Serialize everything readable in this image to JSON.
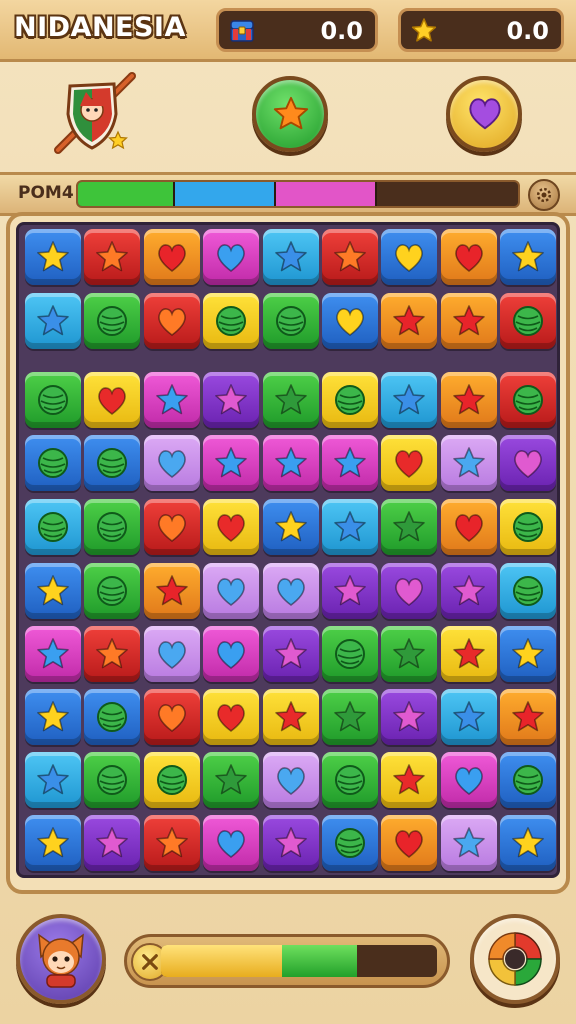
{
  "header": {
    "title": "NIDANESIA",
    "moves": {
      "value": "0.0",
      "icon": "treasure-chest-icon"
    },
    "stars": {
      "value": "0.0",
      "icon": "star-icon"
    }
  },
  "toolbar": {
    "badge_icon": "hero-shield-badge-icon",
    "star_booster_icon": "orange-star-booster-icon",
    "heart_booster_icon": "purple-heart-booster-icon"
  },
  "score_panel": {
    "label": "POM4",
    "segments": [
      {
        "color": "#3ec43a",
        "fraction": 0.22
      },
      {
        "color": "#33a7ec",
        "fraction": 0.23
      },
      {
        "color": "#e255c8",
        "fraction": 0.23
      }
    ],
    "settings_icon": "gear-icon"
  },
  "board": {
    "rows": 10,
    "cols": 9,
    "tiles": [
      [
        "blue:star",
        "red:star",
        "orange:heart",
        "magenta:heart",
        "cyan:star",
        "red:star",
        "blue:heart",
        "orange:heart",
        "blue:star"
      ],
      [
        "cyan:star",
        "green:ball",
        "red:heart",
        "yellow:ball",
        "green:ball",
        "blue:heart",
        "orange:star",
        "orange:star",
        "red:ball"
      ],
      [
        "green:ball",
        "yellow:heart",
        "magenta:star",
        "purple:star",
        "green:star",
        "yellow:ball",
        "cyan:star",
        "orange:star",
        "red:ball"
      ],
      [
        "blue:ball",
        "blue:ball",
        "lavender:heart",
        "magenta:star",
        "magenta:star",
        "magenta:star",
        "yellow:heart",
        "lavender:star",
        "purple:heart"
      ],
      [
        "cyan:ball",
        "green:ball",
        "red:heart",
        "yellow:heart",
        "blue:star",
        "cyan:star",
        "green:star",
        "orange:heart",
        "yellow:ball"
      ],
      [
        "blue:star",
        "green:ball",
        "orange:star",
        "lavender:heart",
        "lavender:heart",
        "purple:star",
        "purple:heart",
        "purple:star",
        "cyan:ball"
      ],
      [
        "magenta:star",
        "red:star",
        "lavender:heart",
        "magenta:heart",
        "purple:star",
        "green:ball",
        "green:star",
        "yellow:star",
        "blue:star"
      ],
      [
        "blue:star",
        "blue:ball",
        "red:heart",
        "yellow:heart",
        "yellow:star",
        "green:star",
        "purple:star",
        "cyan:star",
        "orange:star"
      ],
      [
        "cyan:star",
        "green:ball",
        "yellow:ball",
        "green:star",
        "lavender:heart",
        "green:ball",
        "yellow:star",
        "magenta:heart",
        "blue:ball"
      ],
      [
        "blue:star",
        "purple:star",
        "red:star",
        "magenta:heart",
        "purple:star",
        "blue:ball",
        "orange:heart",
        "lavender:star",
        "blue:star"
      ]
    ]
  },
  "bottom": {
    "avatar_icon": "cat-hero-avatar-icon",
    "cancel_icon": "close-icon",
    "progress": {
      "yellow_fraction": 0.44,
      "green_fraction": 0.27
    },
    "dial_icon": "color-wheel-icon"
  }
}
